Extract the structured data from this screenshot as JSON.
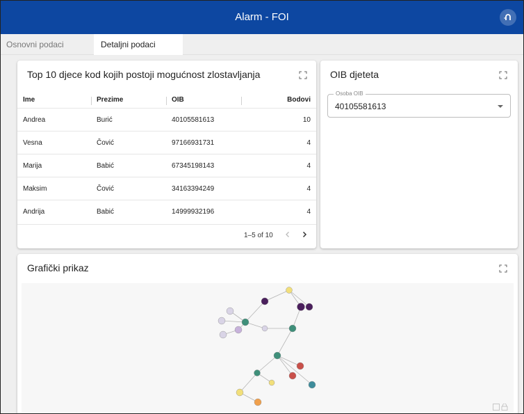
{
  "appbar": {
    "title": "Alarm - FOI",
    "action_icon": "logout-icon"
  },
  "tabs": [
    {
      "label": "Osnovni podaci",
      "active": false
    },
    {
      "label": "Detaljni podaci",
      "active": true
    }
  ],
  "table_card": {
    "title": "Top 10 djece kod kojih postoji mogućnost zlostavljanja",
    "columns": [
      "Ime",
      "Prezime",
      "OIB",
      "Bodovi"
    ],
    "rows": [
      [
        "Andrea",
        "Burić",
        "40105581613",
        "10"
      ],
      [
        "Vesna",
        "Čović",
        "97166931731",
        "4"
      ],
      [
        "Marija",
        "Babić",
        "67345198143",
        "4"
      ],
      [
        "Maksim",
        "Čović",
        "34163394249",
        "4"
      ],
      [
        "Andrija",
        "Babić",
        "14999932196",
        "4"
      ]
    ],
    "pagination": "1–5 of 10"
  },
  "oib_card": {
    "title": "OIB djeteta",
    "select_label": "Osoba OIB",
    "select_value": "40105581613"
  },
  "graph_card": {
    "title": "Grafički prikaz"
  },
  "colors": {
    "appbar": "#0d47a1",
    "node_dark": "#4a1f5c",
    "node_teal": "#3f8f7a",
    "node_light": "#d9d4e6",
    "node_lilac": "#c7b2db",
    "node_red": "#c9504a",
    "node_yellow": "#f2df7a",
    "node_orange": "#f0a04c",
    "node_cyan": "#3e8c9b"
  }
}
